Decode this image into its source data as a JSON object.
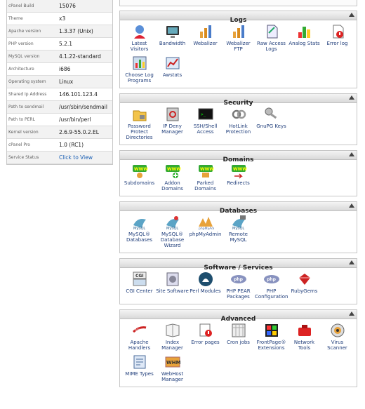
{
  "server_info": [
    {
      "label": "cPanel Build",
      "value": "15076"
    },
    {
      "label": "Theme",
      "value": "x3"
    },
    {
      "label": "Apache version",
      "value": "1.3.37 (Unix)"
    },
    {
      "label": "PHP version",
      "value": "5.2.1"
    },
    {
      "label": "MySQL version",
      "value": "4.1.22-standard"
    },
    {
      "label": "Architecture",
      "value": "i686"
    },
    {
      "label": "Operating system",
      "value": "Linux"
    },
    {
      "label": "Shared Ip Address",
      "value": "146.101.123.4"
    },
    {
      "label": "Path to sendmail",
      "value": "/usr/sbin/sendmail"
    },
    {
      "label": "Path to PERL",
      "value": "/usr/bin/perl"
    },
    {
      "label": "Kernel version",
      "value": "2.6.9-55.0.2.EL"
    },
    {
      "label": "cPanel Pro",
      "value": "1.0 (RC1)"
    },
    {
      "label": "Service Status",
      "value": "Click to View"
    }
  ],
  "sections": [
    {
      "title": "Logs",
      "items": [
        {
          "label": "Latest Visitors",
          "icon": "latest-visitors-icon"
        },
        {
          "label": "Bandwidth",
          "icon": "bandwidth-icon"
        },
        {
          "label": "Webalizer",
          "icon": "webalizer-icon"
        },
        {
          "label": "Webalizer FTP",
          "icon": "webalizer-ftp-icon"
        },
        {
          "label": "Raw Access Logs",
          "icon": "raw-access-logs-icon"
        },
        {
          "label": "Analog Stats",
          "icon": "analog-stats-icon"
        },
        {
          "label": "Error log",
          "icon": "error-log-icon"
        },
        {
          "label": "Choose Log Programs",
          "icon": "choose-log-programs-icon"
        },
        {
          "label": "Awstats",
          "icon": "awstats-icon"
        }
      ]
    },
    {
      "title": "Security",
      "items": [
        {
          "label": "Password Protect Directories",
          "icon": "password-protect-icon"
        },
        {
          "label": "IP Deny Manager",
          "icon": "ip-deny-icon"
        },
        {
          "label": "SSH/Shell Access",
          "icon": "ssh-shell-icon"
        },
        {
          "label": "HotLink Protection",
          "icon": "hotlink-icon"
        },
        {
          "label": "GnuPG Keys",
          "icon": "gnupg-keys-icon"
        }
      ]
    },
    {
      "title": "Domains",
      "items": [
        {
          "label": "Subdomains",
          "icon": "subdomains-icon"
        },
        {
          "label": "Addon Domains",
          "icon": "addon-domains-icon"
        },
        {
          "label": "Parked Domains",
          "icon": "parked-domains-icon"
        },
        {
          "label": "Redirects",
          "icon": "redirects-icon"
        }
      ]
    },
    {
      "title": "Databases",
      "items": [
        {
          "label": "MySQL® Databases",
          "icon": "mysql-databases-icon"
        },
        {
          "label": "MySQL® Database Wizard",
          "icon": "mysql-wizard-icon"
        },
        {
          "label": "phpMyAdmin",
          "icon": "phpmyadmin-icon"
        },
        {
          "label": "Remote MySQL",
          "icon": "remote-mysql-icon"
        }
      ]
    },
    {
      "title": "Software / Services",
      "items": [
        {
          "label": "CGI Center",
          "icon": "cgi-center-icon"
        },
        {
          "label": "Site Software",
          "icon": "site-software-icon"
        },
        {
          "label": "Perl Modules",
          "icon": "perl-modules-icon"
        },
        {
          "label": "PHP PEAR Packages",
          "icon": "php-pear-icon"
        },
        {
          "label": "PHP Configuration",
          "icon": "php-config-icon"
        },
        {
          "label": "RubyGems",
          "icon": "rubygems-icon"
        }
      ]
    },
    {
      "title": "Advanced",
      "items": [
        {
          "label": "Apache Handlers",
          "icon": "apache-handlers-icon"
        },
        {
          "label": "Index Manager",
          "icon": "index-manager-icon"
        },
        {
          "label": "Error pages",
          "icon": "error-pages-icon"
        },
        {
          "label": "Cron jobs",
          "icon": "cron-jobs-icon"
        },
        {
          "label": "FrontPage® Extensions",
          "icon": "frontpage-icon"
        },
        {
          "label": "Network Tools",
          "icon": "network-tools-icon"
        },
        {
          "label": "Virus Scanner",
          "icon": "virus-scanner-icon"
        },
        {
          "label": "MIME Types",
          "icon": "mime-types-icon"
        },
        {
          "label": "WebHost Manager",
          "icon": "webhost-manager-icon"
        }
      ]
    }
  ],
  "colors": {
    "link": "#1f3d7a",
    "panel_header": "#d9d9d9",
    "accent_orange": "#e8a23a",
    "accent_blue": "#3a6fc4"
  }
}
